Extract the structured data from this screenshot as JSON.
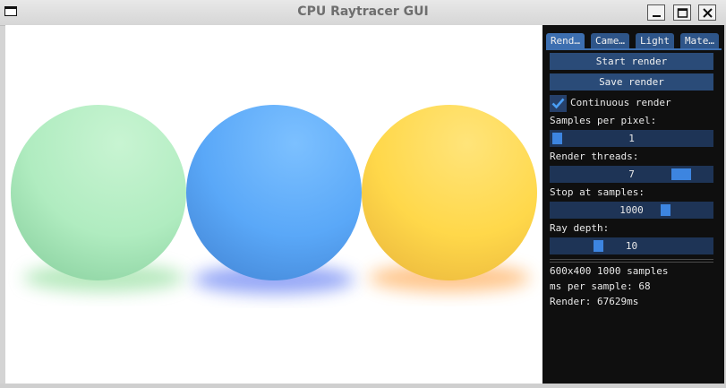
{
  "window": {
    "title": "CPU Raytracer GUI"
  },
  "tabs": [
    {
      "label": "Rend…"
    },
    {
      "label": "Came…"
    },
    {
      "label": "Light"
    },
    {
      "label": "Mate…"
    }
  ],
  "render_panel": {
    "start_label": "Start render",
    "save_label": "Save render",
    "continuous_label": "Continuous render",
    "continuous_checked": true,
    "samples_per_pixel": {
      "label": "Samples per pixel:",
      "value": "1",
      "fraction": 0.0
    },
    "render_threads": {
      "label": "Render threads:",
      "value": "7",
      "fraction": 0.86
    },
    "stop_at_samples": {
      "label": "Stop at samples:",
      "value": "1000",
      "fraction": 0.73
    },
    "ray_depth": {
      "label": "Ray depth:",
      "value": "10",
      "fraction": 0.28
    }
  },
  "stats": {
    "resolution_samples": "600x400 1000 samples",
    "ms_per_sample": "ms per sample: 68",
    "render_time": "Render: 67629ms"
  },
  "scene": {
    "spheres": [
      {
        "name": "green-sphere",
        "color": "#a8e8b8"
      },
      {
        "name": "blue-sphere",
        "color": "#5aa8f8"
      },
      {
        "name": "yellow-sphere",
        "color": "#ffd84a"
      }
    ]
  },
  "colors": {
    "accent": "#3d85e0",
    "button": "#2a4b78",
    "panel_bg": "#0f0f0f"
  }
}
